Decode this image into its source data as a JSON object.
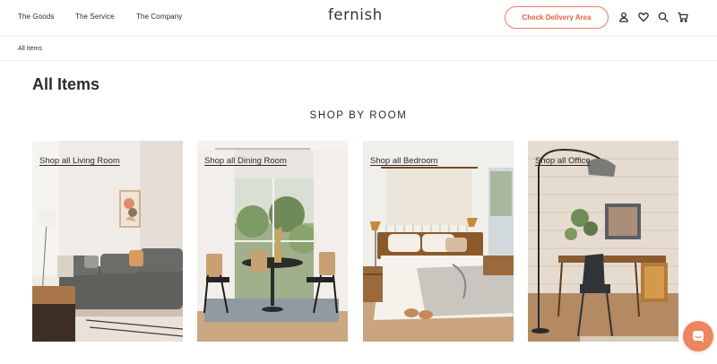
{
  "header": {
    "nav": [
      {
        "label": "The Goods"
      },
      {
        "label": "The Service"
      },
      {
        "label": "The Company"
      }
    ],
    "logo": "fernish",
    "cta_label": "Check Delivery Area",
    "icons": [
      "account-icon",
      "heart-icon",
      "search-icon",
      "cart-icon"
    ]
  },
  "breadcrumb": "All Items",
  "page_title": "All Items",
  "section_title": "SHOP BY ROOM",
  "rooms": [
    {
      "label": "Shop all Living Room"
    },
    {
      "label": "Shop all Dining Room"
    },
    {
      "label": "Shop all Bedroom"
    },
    {
      "label": "Shop all Office"
    }
  ],
  "colors": {
    "accent": "#e8613f",
    "chat_button": "#ee8560",
    "text": "#2b2b2b"
  }
}
